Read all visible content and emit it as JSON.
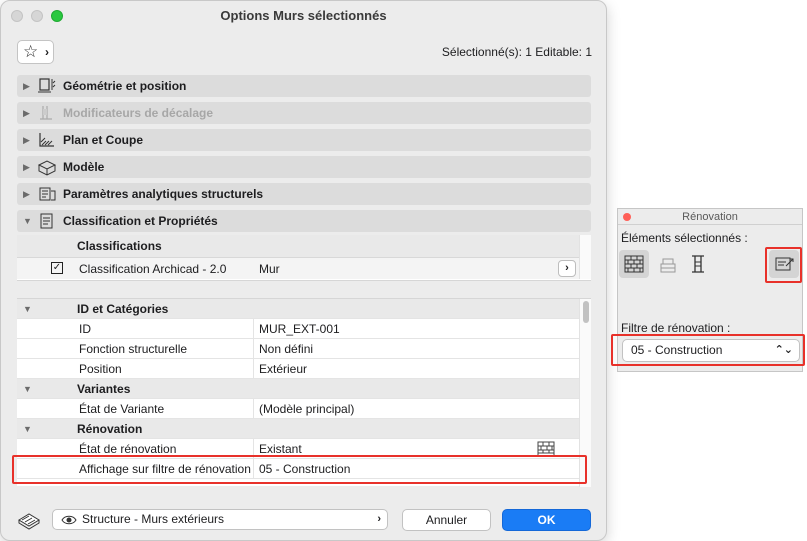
{
  "dialog": {
    "title": "Options Murs sélectionnés",
    "selection_info": "Sélectionné(s): 1 Editable: 1",
    "panels": [
      {
        "label": "Géométrie et position",
        "icon": "geometry-icon",
        "enabled": true,
        "expanded": false
      },
      {
        "label": "Modificateurs de décalage",
        "icon": "offset-modifier-icon",
        "enabled": false,
        "expanded": false
      },
      {
        "label": "Plan et Coupe",
        "icon": "plan-section-icon",
        "enabled": true,
        "expanded": false
      },
      {
        "label": "Modèle",
        "icon": "model-icon",
        "enabled": true,
        "expanded": false
      },
      {
        "label": "Paramètres analytiques structurels",
        "icon": "structural-analytics-icon",
        "enabled": true,
        "expanded": false
      },
      {
        "label": "Classification et Propriétés",
        "icon": "classification-icon",
        "enabled": true,
        "expanded": true
      }
    ],
    "classifications": {
      "header": "Classifications",
      "row": {
        "name": "Classification Archicad - 2.0",
        "value": "Mur",
        "checked": true
      }
    },
    "properties": {
      "groups": [
        {
          "label": "ID et Catégories",
          "rows": [
            {
              "name": "ID",
              "value": "MUR_EXT-001"
            },
            {
              "name": "Fonction structurelle",
              "value": "Non défini"
            },
            {
              "name": "Position",
              "value": "Extérieur"
            }
          ]
        },
        {
          "label": "Variantes",
          "rows": [
            {
              "name": "État de Variante",
              "value": "(Modèle principal)"
            }
          ]
        },
        {
          "label": "Rénovation",
          "rows": [
            {
              "name": "État de rénovation",
              "value": "Existant",
              "icon": "brick-wall-icon"
            },
            {
              "name": "Affichage sur filtre de rénovation",
              "value": "05 - Construction",
              "highlighted": true
            }
          ]
        }
      ]
    },
    "layer": "Structure - Murs extérieurs",
    "cancel_label": "Annuler",
    "ok_label": "OK"
  },
  "palette": {
    "title": "Rénovation",
    "selected_label": "Éléments sélectionnés :",
    "filter_label": "Filtre de rénovation :",
    "filter_value": "05 - Construction"
  },
  "colors": {
    "accent": "#1a7cf5",
    "highlight": "#e8312a",
    "panel_header": "#dcdcdc"
  }
}
